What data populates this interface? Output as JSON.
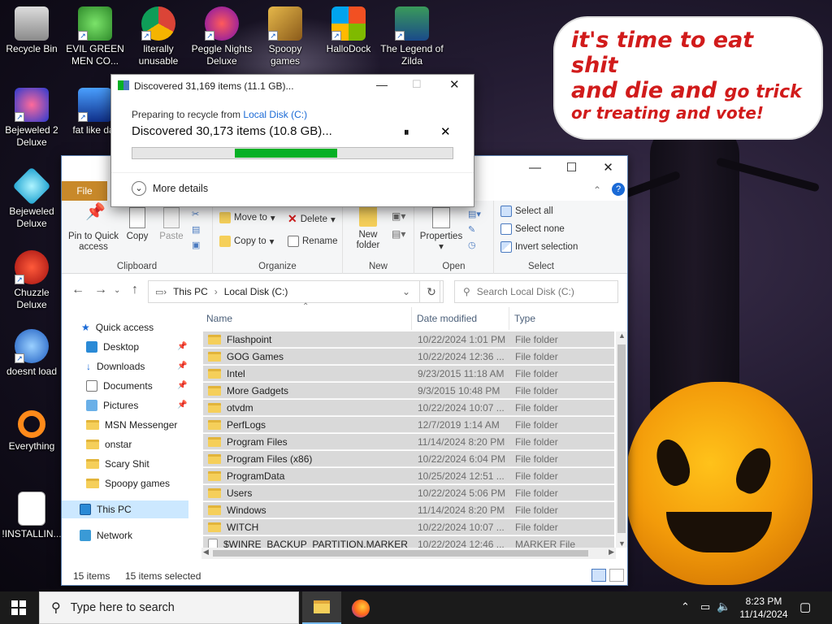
{
  "desktop": {
    "icons": [
      {
        "label": "Recycle Bin"
      },
      {
        "label": "EVIL GREEN MEN CO..."
      },
      {
        "label": "literally unusable"
      },
      {
        "label": "Peggle Nights Deluxe"
      },
      {
        "label": "Spoopy games"
      },
      {
        "label": "HalloDock"
      },
      {
        "label": "The Legend of Zilda"
      },
      {
        "label": "Bejeweled 2 Deluxe"
      },
      {
        "label": "fat like dar"
      },
      {
        "label": "Bejeweled Deluxe"
      },
      {
        "label": "Chuzzle Deluxe"
      },
      {
        "label": "doesnt load"
      },
      {
        "label": "Everything"
      },
      {
        "label": "!INSTALLIN..."
      }
    ],
    "speech": {
      "line1": "it's time to eat shit",
      "line2a": "and die and",
      "line2b": "go trick",
      "line3": "or treating and vote!"
    }
  },
  "dialog": {
    "title": "Discovered 31,169 items (11.1 GB)...",
    "from_prefix": "Preparing to recycle from",
    "from_location": "Local Disk (C:)",
    "status": "Discovered 30,173 items (10.8 GB)...",
    "progress_start": 0.32,
    "progress_end": 0.64,
    "more_details": "More details"
  },
  "explorer": {
    "tabs": {
      "file": "File"
    },
    "ribbon": {
      "clipboard": {
        "label": "Clipboard",
        "pin": "Pin to Quick access",
        "copy": "Copy",
        "paste": "Paste"
      },
      "organize": {
        "label": "Organize",
        "move_to": "Move to",
        "copy_to": "Copy to",
        "delete": "Delete",
        "rename": "Rename"
      },
      "new": {
        "label": "New",
        "new_folder": "New folder"
      },
      "open": {
        "label": "Open",
        "properties": "Properties"
      },
      "select": {
        "label": "Select",
        "select_all": "Select all",
        "select_none": "Select none",
        "invert": "Invert selection"
      }
    },
    "address": {
      "root": "This PC",
      "current": "Local Disk (C:)"
    },
    "search_placeholder": "Search Local Disk (C:)",
    "nav": {
      "quick_access": "Quick access",
      "items": [
        {
          "label": "Desktop"
        },
        {
          "label": "Downloads"
        },
        {
          "label": "Documents"
        },
        {
          "label": "Pictures"
        },
        {
          "label": "MSN Messenger"
        },
        {
          "label": "onstar"
        },
        {
          "label": "Scary Shit"
        },
        {
          "label": "Spoopy games"
        }
      ],
      "this_pc": "This PC",
      "network": "Network"
    },
    "columns": {
      "name": "Name",
      "date": "Date modified",
      "type": "Type"
    },
    "rows": [
      {
        "name": "Flashpoint",
        "date": "10/22/2024 1:01 PM",
        "type": "File folder"
      },
      {
        "name": "GOG Games",
        "date": "10/22/2024 12:36 ...",
        "type": "File folder"
      },
      {
        "name": "Intel",
        "date": "9/23/2015 11:18 AM",
        "type": "File folder"
      },
      {
        "name": "More Gadgets",
        "date": "9/3/2015 10:48 PM",
        "type": "File folder"
      },
      {
        "name": "otvdm",
        "date": "10/22/2024 10:07 ...",
        "type": "File folder"
      },
      {
        "name": "PerfLogs",
        "date": "12/7/2019 1:14 AM",
        "type": "File folder"
      },
      {
        "name": "Program Files",
        "date": "11/14/2024 8:20 PM",
        "type": "File folder"
      },
      {
        "name": "Program Files (x86)",
        "date": "10/22/2024 6:04 PM",
        "type": "File folder"
      },
      {
        "name": "ProgramData",
        "date": "10/25/2024 12:51 ...",
        "type": "File folder"
      },
      {
        "name": "Users",
        "date": "10/22/2024 5:06 PM",
        "type": "File folder"
      },
      {
        "name": "Windows",
        "date": "11/14/2024 8:20 PM",
        "type": "File folder"
      },
      {
        "name": "WITCH",
        "date": "10/22/2024 10:07 ...",
        "type": "File folder"
      },
      {
        "name": "$WINRE_BACKUP_PARTITION.MARKER",
        "date": "10/22/2024 12:46 ...",
        "type": "MARKER File"
      }
    ],
    "status": {
      "count": "15 items",
      "selected": "15 items selected"
    }
  },
  "taskbar": {
    "search_placeholder": "Type here to search",
    "time": "8:23 PM",
    "date": "11/14/2024"
  }
}
